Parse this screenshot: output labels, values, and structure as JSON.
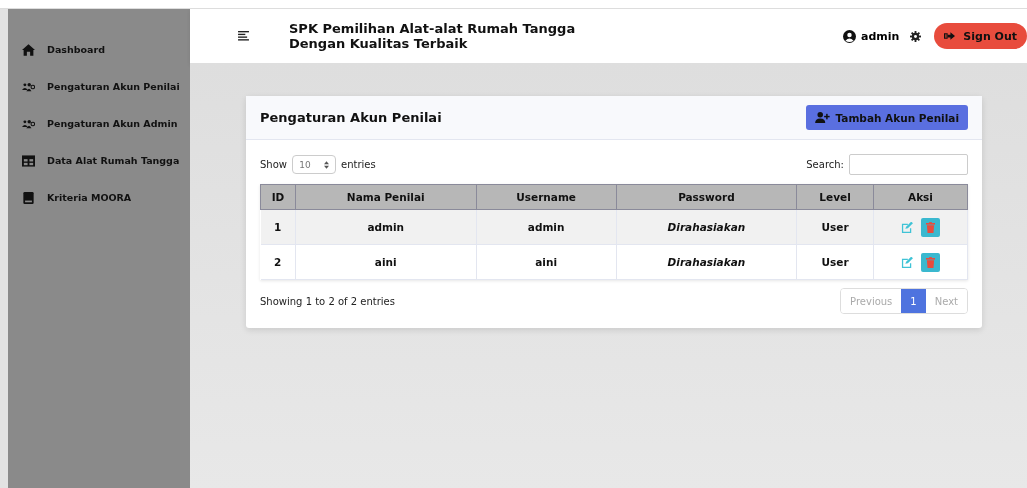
{
  "sidebar": {
    "items": [
      {
        "label": "Dashboard",
        "kind": "home"
      },
      {
        "label": "Pengaturan Akun Penilai",
        "kind": "users"
      },
      {
        "label": "Pengaturan Akun Admin",
        "kind": "users"
      },
      {
        "label": "Data Alat Rumah Tangga",
        "kind": "table"
      },
      {
        "label": "Kriteria MOORA",
        "kind": "book"
      }
    ]
  },
  "header": {
    "title_lines": [
      "SPK Pemilihan Alat-alat Rumah Tangga",
      "Dengan Kualitas Terbaik"
    ],
    "user": "admin",
    "sign_out": "Sign Out"
  },
  "card": {
    "title": "Pengaturan Akun Penilai",
    "add_button": "Tambah Akun Penilai",
    "length": {
      "show": "Show",
      "value": "10",
      "entries": "entries"
    },
    "search_label": "Search:",
    "table": {
      "columns": [
        "ID",
        "Nama Penilai",
        "Username",
        "Password",
        "Level",
        "Aksi"
      ],
      "rows": [
        {
          "id": "1",
          "name": "admin",
          "username": "admin",
          "password": "Dirahasiakan",
          "level": "User"
        },
        {
          "id": "2",
          "name": "aini",
          "username": "aini",
          "password": "Dirahasiakan",
          "level": "User"
        }
      ]
    },
    "info": "Showing 1 to 2 of 2 entries",
    "pagination": {
      "previous": {
        "label": "Previous",
        "disabled": true
      },
      "pages": [
        {
          "label": "1",
          "selected": true
        }
      ],
      "next": {
        "label": "Next",
        "disabled": true
      }
    }
  }
}
